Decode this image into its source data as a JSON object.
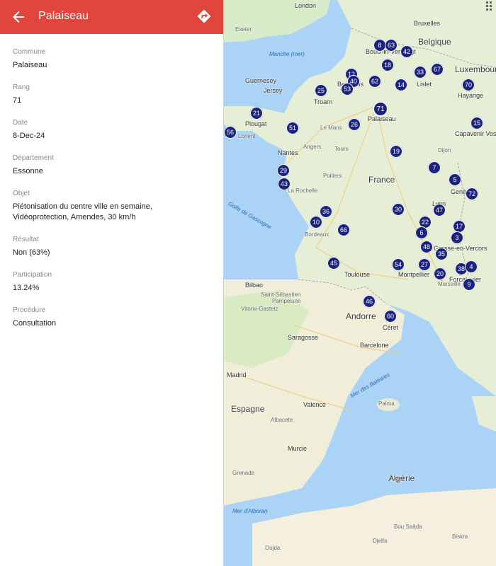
{
  "header": {
    "title": "Palaiseau",
    "bg_color": "#e0463b"
  },
  "fields": [
    {
      "label": "Commune",
      "value": "Palaiseau"
    },
    {
      "label": "Rang",
      "value": "71"
    },
    {
      "label": "Date",
      "value": "8-Dec-24"
    },
    {
      "label": "Département",
      "value": "Essonne"
    },
    {
      "label": "Objet",
      "value": "Piétonisation du centre ville en semaine, Vidéoprotection, Amendes, 30 km/h"
    },
    {
      "label": "Résultat",
      "value": "Non (63%)"
    },
    {
      "label": "Participation",
      "value": "13.24%"
    },
    {
      "label": "Procédure",
      "value": "Consultation"
    }
  ],
  "map": {
    "countries": {
      "belgique": "Belgique",
      "luxembourg": "Luxembourg",
      "france": "France",
      "espagne": "Espagne",
      "andorre": "Andorre",
      "algerie": "Algérie"
    },
    "waters": {
      "manche": "Manche (mer)",
      "gascogne": "Golfe de Gascogne",
      "baleares": "Mer des Baléares",
      "alboran": "Mer d'Alboran"
    },
    "places": {
      "exeter": "Exeter",
      "london": "London",
      "bruxelles": "Bruxelles",
      "lille": "Lille",
      "guernesey": "Guernesey",
      "jersey": "Jersey",
      "troarn": "Troarn",
      "beauvais": "Beauvais",
      "plougat": "Plougat",
      "lorient": "Lorient",
      "le_mans": "Le Mans",
      "nantes": "Nantes",
      "tours": "Tours",
      "angers": "Angers",
      "poitiers": "Poitiers",
      "la_rochelle": "La Rochelle",
      "bordeaux": "Bordeaux",
      "toulouse": "Toulouse",
      "montpellier": "Montpellier",
      "marseille": "Marseille",
      "lyon": "Lyon",
      "geneve": "Genève",
      "dijon": "Dijon",
      "bilbao": "Bilbao",
      "saint_sebastien": "Saint-Sébastien",
      "pampelune": "Pampelune",
      "vitoria": "Vitoria-Gasteiz",
      "saragosse": "Saragosse",
      "barcelone": "Barcelone",
      "madrid": "Madrid",
      "valence": "Valence",
      "albacete": "Albacete",
      "murcie": "Murcie",
      "grenade": "Grenade",
      "alger": "Alger",
      "ceret": "Céret",
      "palaiseau": "Palaiseau",
      "hayange": "Hayange",
      "lislet": "Lislet",
      "forcalquier": "Forcalquier",
      "gresse": "Gresse-en-Vercors",
      "capavenir": "Capavenir Vosges",
      "bouchain": "Bouchin-Verloingt",
      "palma": "Palma",
      "valencia_label": "Valence",
      "oujda": "Oujda",
      "djelfa": "Djelfa",
      "biskra": "Biskra",
      "bou_saada": "Bou Saâda"
    },
    "markers": [
      "8",
      "63",
      "42",
      "18",
      "33",
      "67",
      "12",
      "40",
      "62",
      "14",
      "70",
      "53",
      "25",
      "71",
      "21",
      "56",
      "51",
      "26",
      "15",
      "19",
      "7",
      "29",
      "43",
      "5",
      "72",
      "30",
      "47",
      "36",
      "10",
      "66",
      "22",
      "6",
      "17",
      "3",
      "48",
      "35",
      "45",
      "54",
      "27",
      "20",
      "38",
      "4",
      "9",
      "46",
      "60"
    ],
    "selected_marker": "71",
    "marker_color": "#1a237e"
  }
}
